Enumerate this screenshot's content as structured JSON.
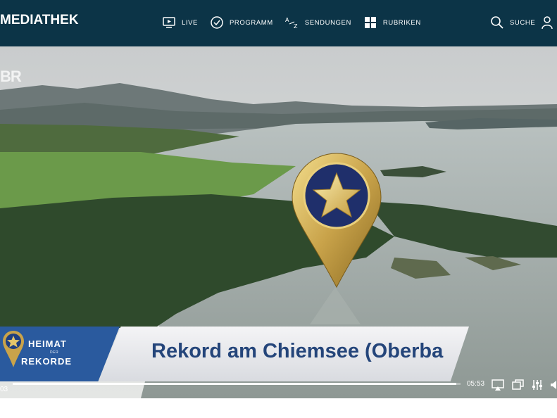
{
  "header": {
    "logo": "MEDIATHEK",
    "nav": [
      {
        "label": "LIVE",
        "icon": "live-tv-icon"
      },
      {
        "label": "PROGRAMM",
        "icon": "clock-check-icon"
      },
      {
        "label": "SENDUNGEN",
        "icon": "a-z-icon"
      },
      {
        "label": "RUBRIKEN",
        "icon": "grid-icon"
      }
    ],
    "search_label": "SUCHE",
    "search_icon": "search-icon",
    "profile_icon": "user-icon"
  },
  "video": {
    "watermark": "BR",
    "lower_third": {
      "show_line1": "HEIMAT",
      "show_der": "DER",
      "show_line2": "REKORDE",
      "title": "Rekord am Chiemsee (Oberba"
    },
    "progress_fraction": 0.99,
    "current_time": "03",
    "duration": "05:53",
    "controls": [
      "airplay-icon",
      "picture-in-picture-icon",
      "settings-sliders-icon",
      "volume-icon"
    ]
  },
  "colors": {
    "header_bg": "#0c3447",
    "lower_third_blue": "#2a5a9e",
    "title_text": "#24457a",
    "pin_gold": "#d4b25a",
    "pin_navy": "#1f2f6b"
  }
}
